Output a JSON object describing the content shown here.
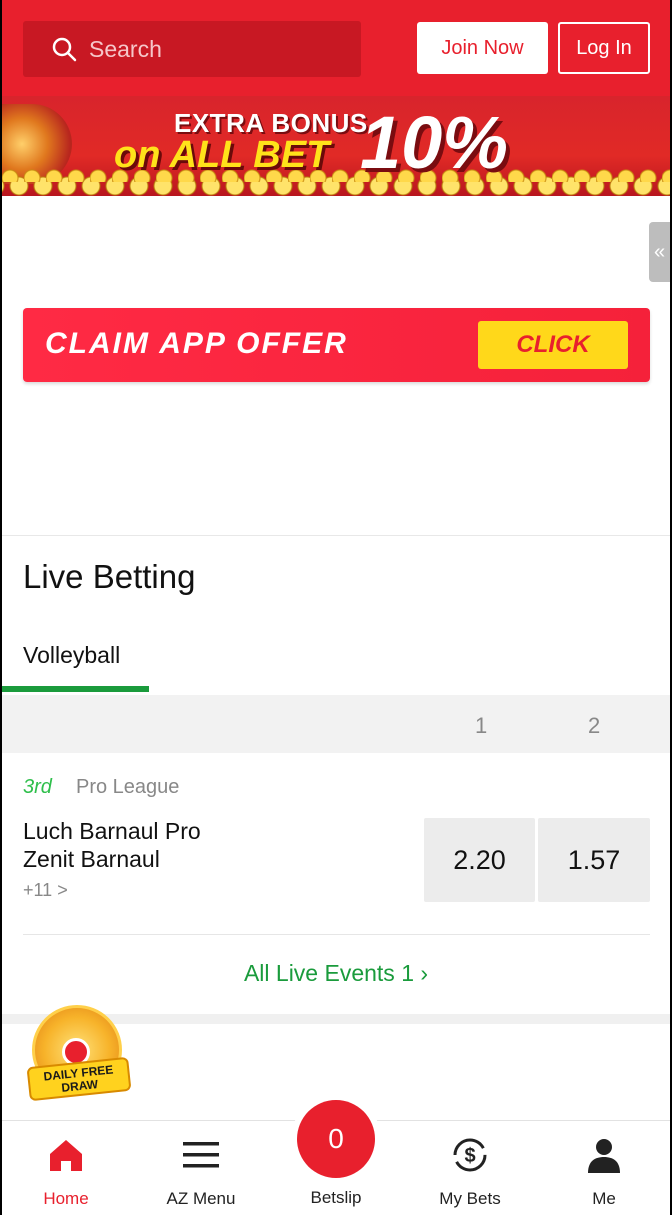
{
  "header": {
    "search_placeholder": "Search",
    "join_label": "Join Now",
    "login_label": "Log In"
  },
  "promo_banner": {
    "line1": "EXTRA BONUS",
    "line2": "on ALL BET",
    "percent": "10%"
  },
  "side_tab": {
    "glyph": "«"
  },
  "claim_banner": {
    "text": "CLAIM APP OFFER",
    "button": "CLICK"
  },
  "live": {
    "title": "Live Betting",
    "tab": "Volleyball",
    "columns": [
      "1",
      "2"
    ],
    "event": {
      "period": "3rd",
      "league": "Pro League",
      "team_home": "Luch Barnaul Pro",
      "team_away": "Zenit Barnaul",
      "more_markets": "+11 >",
      "odds": [
        "2.20",
        "1.57"
      ]
    },
    "all_events": "All Live Events 1 ›"
  },
  "daily_draw": {
    "label": "DAILY FREE DRAW"
  },
  "nav": {
    "home": "Home",
    "az_menu": "AZ Menu",
    "betslip": "Betslip",
    "betslip_count": "0",
    "my_bets": "My Bets",
    "me": "Me"
  },
  "colors": {
    "brand_red": "#e8202d",
    "accent_green": "#1a9b3c",
    "claim_yellow": "#ffd81a"
  }
}
